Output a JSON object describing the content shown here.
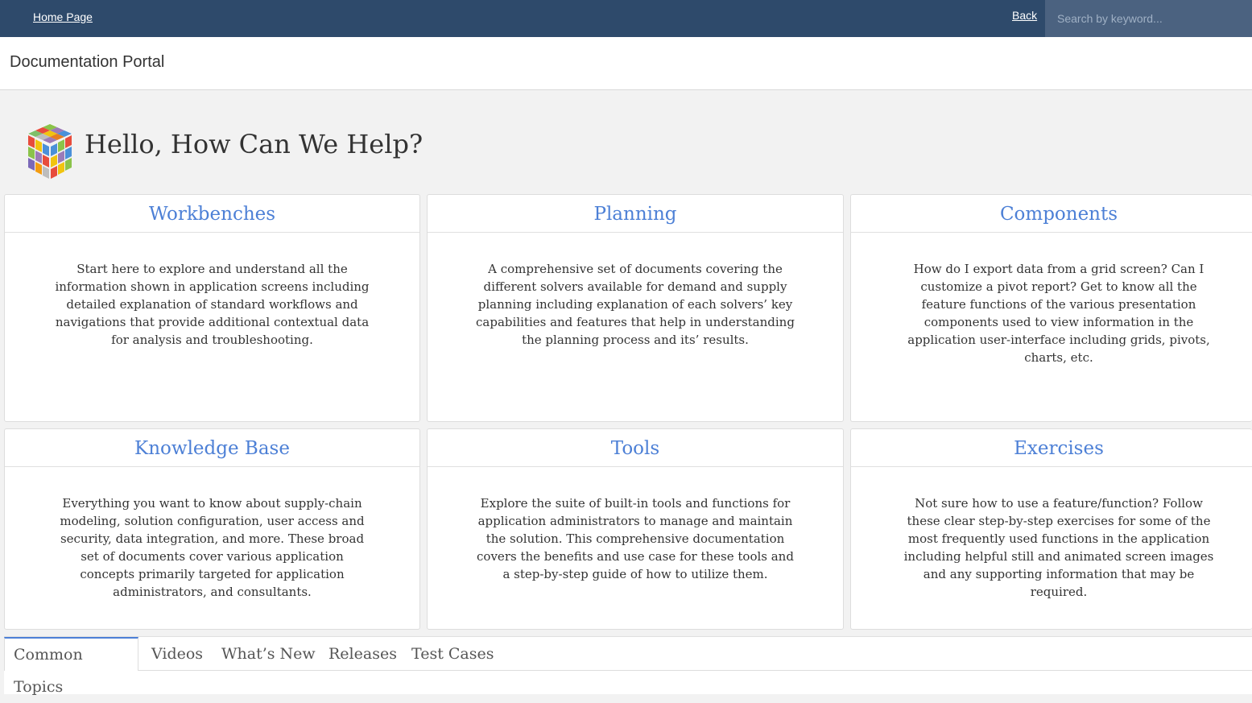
{
  "topbar": {
    "home_label": "Home Page",
    "back_label": "Back",
    "search_placeholder": "Search by keyword..."
  },
  "header": {
    "title": "Documentation Portal"
  },
  "hero": {
    "title": "Hello, How Can We Help?",
    "logo_icon": "rubiks-cube-icon"
  },
  "cards": [
    {
      "title": "Workbenches",
      "description": "Start here to explore and understand all the information shown in application screens including detailed explanation of standard workflows and navigations that provide additional contextual data for analysis and troubleshooting."
    },
    {
      "title": "Planning",
      "description": "A comprehensive set of documents covering the different solvers available for demand and supply planning including explanation of each solvers’ key capabilities and features that help in understanding the planning process and its’ results."
    },
    {
      "title": "Components",
      "description": "How do I export data from a grid screen? Can I customize a pivot report? Get to know all the feature functions of the various presentation components used to view information in the application user-interface including grids, pivots, charts, etc."
    },
    {
      "title": "Knowledge Base",
      "description": "Everything you want to know about supply-chain modeling, solution configuration, user access and security, data integration, and more. These broad set of documents cover various application concepts primarily targeted for application administrators, and consultants."
    },
    {
      "title": "Tools",
      "description": "Explore the suite of built-in tools and functions for application administrators to manage and maintain the solution. This comprehensive documentation covers the benefits and use case for these tools and a step-by-step guide of how to utilize them."
    },
    {
      "title": "Exercises",
      "description": "Not sure how to use a feature/function? Follow these clear step-by-step exercises for some of the most frequently used functions in the application including helpful still and animated screen images and any supporting information that may be required."
    }
  ],
  "tabs": [
    {
      "label": "Common Topics",
      "active": true
    },
    {
      "label": "Videos",
      "active": false
    },
    {
      "label": "What’s New",
      "active": false
    },
    {
      "label": "Releases",
      "active": false
    },
    {
      "label": "Test Cases",
      "active": false
    }
  ],
  "colors": {
    "topbar": "#2e4a6b",
    "accent": "#4d80d6",
    "background": "#f2f2f2"
  }
}
